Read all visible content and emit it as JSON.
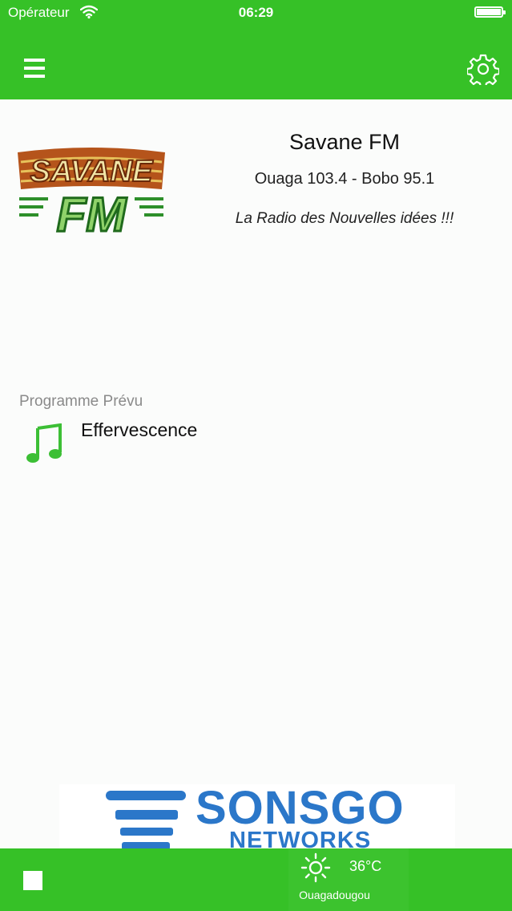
{
  "status_bar": {
    "carrier": "Opérateur",
    "time": "06:29"
  },
  "nav": {
    "menu_icon": "hamburger-menu-icon",
    "settings_icon": "gear-icon"
  },
  "station": {
    "logo_alt": "SAVANE FM",
    "name": "Savane FM",
    "frequencies": "Ouaga 103.4 - Bobo 95.1",
    "slogan": "La Radio des Nouvelles idées !!!"
  },
  "program": {
    "label": "Programme Prévu",
    "title": "Effervescence",
    "icon": "music-note-icon"
  },
  "sponsor": {
    "name": "SONSGO",
    "sub": "NETWORKS"
  },
  "player": {
    "stop_icon": "stop-icon"
  },
  "weather": {
    "icon": "sun-icon",
    "temperature": "36°C",
    "city": "Ouagadougou"
  },
  "colors": {
    "brand_green": "#36c127",
    "sponsor_blue": "#2b77c9",
    "note_green": "#3cbf35"
  }
}
